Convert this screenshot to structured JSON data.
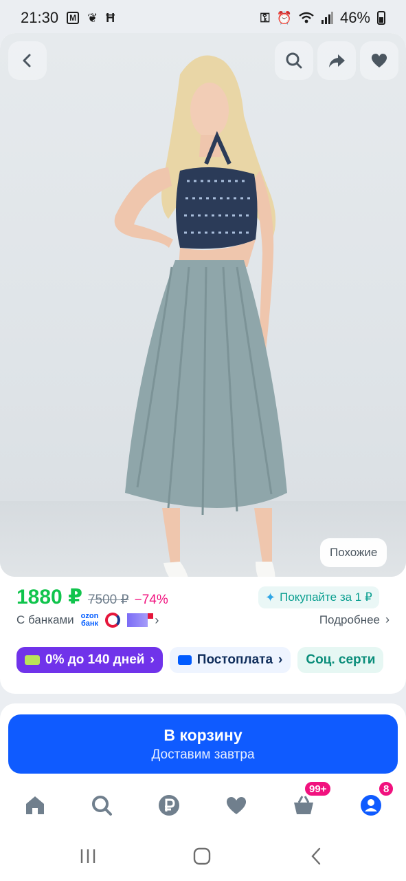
{
  "status_bar": {
    "time": "21:30",
    "battery": "46%",
    "notif_icons": [
      "mi-icon",
      "bird-icon",
      "h-icon"
    ],
    "right_icons": [
      "key-icon",
      "alarm-icon",
      "wifi-icon",
      "signal-icon"
    ]
  },
  "product": {
    "image_alt_icons": {
      "back": "chevron-left-icon",
      "search": "search-icon",
      "share": "share-icon",
      "favorite": "heart-icon"
    },
    "similar_label": "Похожие",
    "price": "1880 ₽",
    "old_price": "7500 ₽",
    "discount": "−74%",
    "buy_for_label": "Покупайте за 1 ₽",
    "banks_label": "С банками",
    "ozon_bank_logo": "ozon банк",
    "details_label": "Подробнее",
    "chips": [
      {
        "label": "0% до 140 дней"
      },
      {
        "label": "Постоплата"
      },
      {
        "label": "Соц. серти"
      }
    ]
  },
  "cart_button": {
    "title": "В корзину",
    "subtitle": "Доставим завтра"
  },
  "tabbar": {
    "items": [
      "home-icon",
      "search-icon",
      "ruble-icon",
      "heart-icon",
      "basket-icon",
      "profile-icon"
    ],
    "cart_badge": "99+",
    "profile_badge": "8"
  },
  "colors": {
    "accent_blue": "#0f5bff",
    "price_green": "#10c44c",
    "discount_pink": "#f1117e",
    "credit_purple": "#7033ea"
  }
}
